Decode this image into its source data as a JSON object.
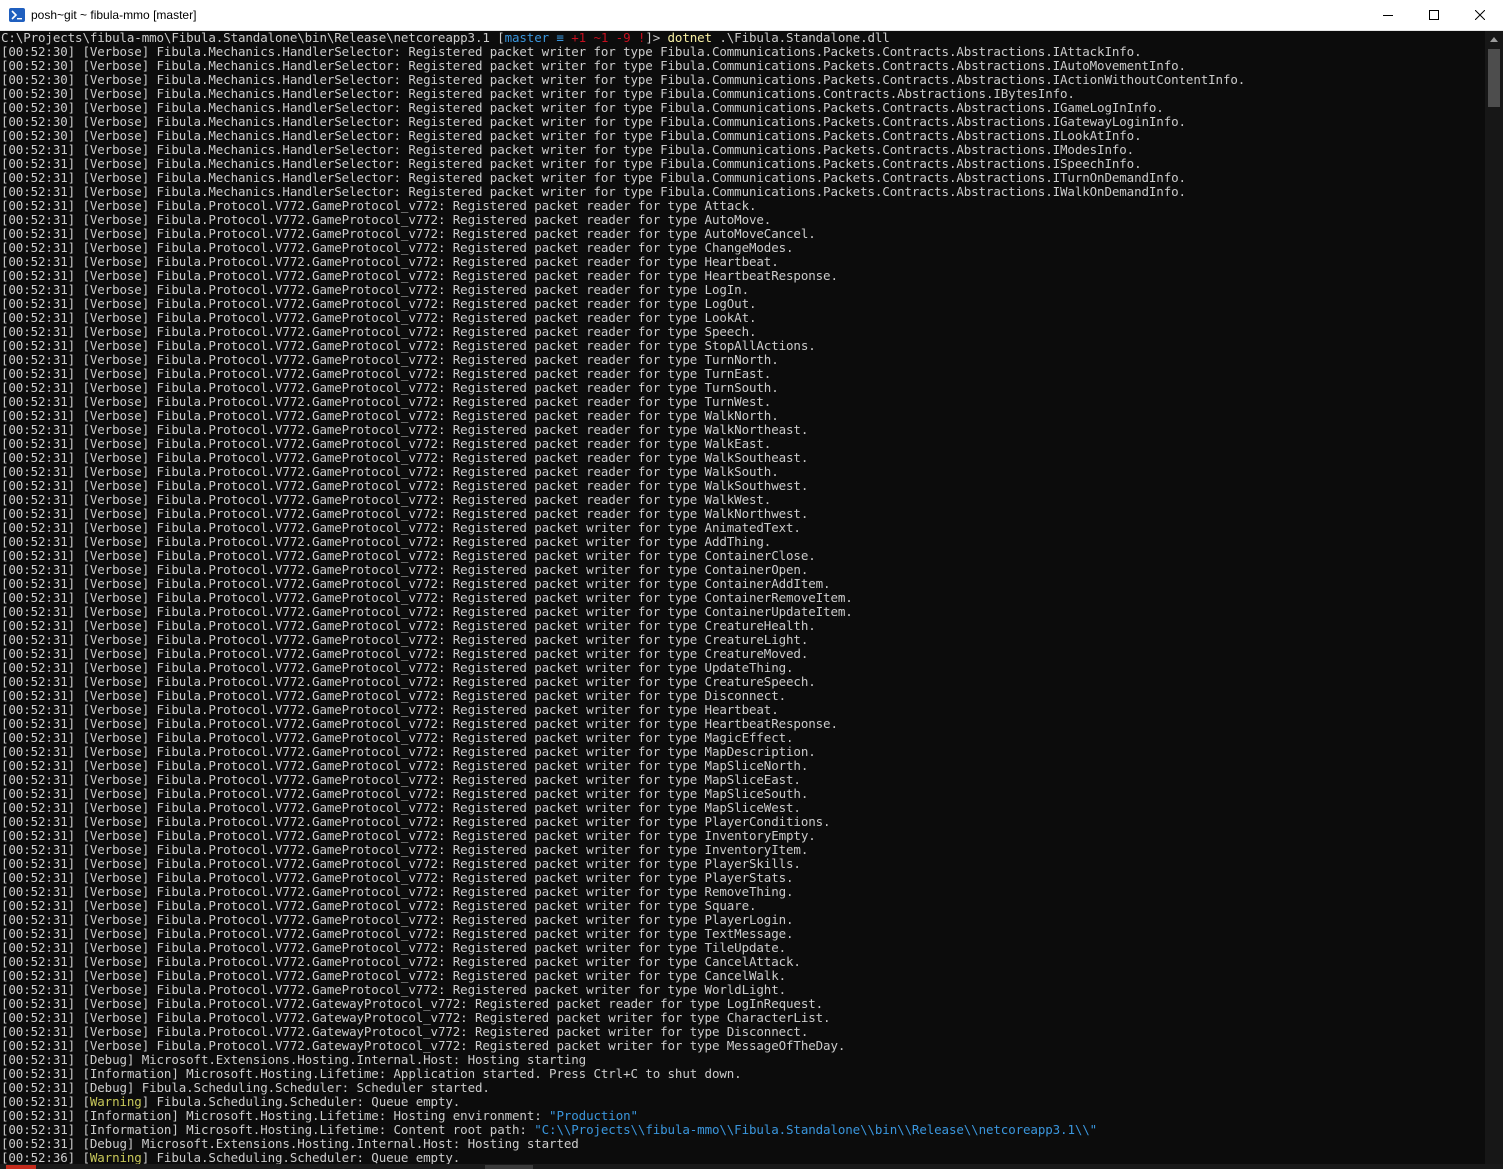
{
  "window": {
    "title": "posh~git ~ fibula-mmo [master]",
    "minimize_glyph": "—",
    "maximize_glyph": "☐",
    "close_glyph": "✕"
  },
  "prompt": {
    "path": "C:\\Projects\\fibula-mmo\\Fibula.Standalone\\bin\\Release\\netcoreapp3.1",
    "git_open": " [",
    "git_branch": "master ≡",
    "git_status": " +1 ~1 -9 !",
    "git_close": "]> ",
    "command": "dotnet",
    "args": " .\\Fibula.Standalone.dll"
  },
  "logs": [
    {
      "t": "00:52:30",
      "level": "Verbose",
      "src": "Fibula.Mechanics.HandlerSelector",
      "msg": "Registered packet writer for type Fibula.Communications.Packets.Contracts.Abstractions.IAttackInfo."
    },
    {
      "t": "00:52:30",
      "level": "Verbose",
      "src": "Fibula.Mechanics.HandlerSelector",
      "msg": "Registered packet writer for type Fibula.Communications.Packets.Contracts.Abstractions.IAutoMovementInfo."
    },
    {
      "t": "00:52:30",
      "level": "Verbose",
      "src": "Fibula.Mechanics.HandlerSelector",
      "msg": "Registered packet writer for type Fibula.Communications.Packets.Contracts.Abstractions.IActionWithoutContentInfo."
    },
    {
      "t": "00:52:30",
      "level": "Verbose",
      "src": "Fibula.Mechanics.HandlerSelector",
      "msg": "Registered packet writer for type Fibula.Communications.Contracts.Abstractions.IBytesInfo."
    },
    {
      "t": "00:52:30",
      "level": "Verbose",
      "src": "Fibula.Mechanics.HandlerSelector",
      "msg": "Registered packet writer for type Fibula.Communications.Packets.Contracts.Abstractions.IGameLogInInfo."
    },
    {
      "t": "00:52:30",
      "level": "Verbose",
      "src": "Fibula.Mechanics.HandlerSelector",
      "msg": "Registered packet writer for type Fibula.Communications.Packets.Contracts.Abstractions.IGatewayLoginInfo."
    },
    {
      "t": "00:52:30",
      "level": "Verbose",
      "src": "Fibula.Mechanics.HandlerSelector",
      "msg": "Registered packet writer for type Fibula.Communications.Packets.Contracts.Abstractions.ILookAtInfo."
    },
    {
      "t": "00:52:31",
      "level": "Verbose",
      "src": "Fibula.Mechanics.HandlerSelector",
      "msg": "Registered packet writer for type Fibula.Communications.Packets.Contracts.Abstractions.IModesInfo."
    },
    {
      "t": "00:52:31",
      "level": "Verbose",
      "src": "Fibula.Mechanics.HandlerSelector",
      "msg": "Registered packet writer for type Fibula.Communications.Packets.Contracts.Abstractions.ISpeechInfo."
    },
    {
      "t": "00:52:31",
      "level": "Verbose",
      "src": "Fibula.Mechanics.HandlerSelector",
      "msg": "Registered packet writer for type Fibula.Communications.Packets.Contracts.Abstractions.ITurnOnDemandInfo."
    },
    {
      "t": "00:52:31",
      "level": "Verbose",
      "src": "Fibula.Mechanics.HandlerSelector",
      "msg": "Registered packet writer for type Fibula.Communications.Packets.Contracts.Abstractions.IWalkOnDemandInfo."
    },
    {
      "t": "00:52:31",
      "level": "Verbose",
      "src": "Fibula.Protocol.V772.GameProtocol_v772",
      "msg": "Registered packet reader for type Attack."
    },
    {
      "t": "00:52:31",
      "level": "Verbose",
      "src": "Fibula.Protocol.V772.GameProtocol_v772",
      "msg": "Registered packet reader for type AutoMove."
    },
    {
      "t": "00:52:31",
      "level": "Verbose",
      "src": "Fibula.Protocol.V772.GameProtocol_v772",
      "msg": "Registered packet reader for type AutoMoveCancel."
    },
    {
      "t": "00:52:31",
      "level": "Verbose",
      "src": "Fibula.Protocol.V772.GameProtocol_v772",
      "msg": "Registered packet reader for type ChangeModes."
    },
    {
      "t": "00:52:31",
      "level": "Verbose",
      "src": "Fibula.Protocol.V772.GameProtocol_v772",
      "msg": "Registered packet reader for type Heartbeat."
    },
    {
      "t": "00:52:31",
      "level": "Verbose",
      "src": "Fibula.Protocol.V772.GameProtocol_v772",
      "msg": "Registered packet reader for type HeartbeatResponse."
    },
    {
      "t": "00:52:31",
      "level": "Verbose",
      "src": "Fibula.Protocol.V772.GameProtocol_v772",
      "msg": "Registered packet reader for type LogIn."
    },
    {
      "t": "00:52:31",
      "level": "Verbose",
      "src": "Fibula.Protocol.V772.GameProtocol_v772",
      "msg": "Registered packet reader for type LogOut."
    },
    {
      "t": "00:52:31",
      "level": "Verbose",
      "src": "Fibula.Protocol.V772.GameProtocol_v772",
      "msg": "Registered packet reader for type LookAt."
    },
    {
      "t": "00:52:31",
      "level": "Verbose",
      "src": "Fibula.Protocol.V772.GameProtocol_v772",
      "msg": "Registered packet reader for type Speech."
    },
    {
      "t": "00:52:31",
      "level": "Verbose",
      "src": "Fibula.Protocol.V772.GameProtocol_v772",
      "msg": "Registered packet reader for type StopAllActions."
    },
    {
      "t": "00:52:31",
      "level": "Verbose",
      "src": "Fibula.Protocol.V772.GameProtocol_v772",
      "msg": "Registered packet reader for type TurnNorth."
    },
    {
      "t": "00:52:31",
      "level": "Verbose",
      "src": "Fibula.Protocol.V772.GameProtocol_v772",
      "msg": "Registered packet reader for type TurnEast."
    },
    {
      "t": "00:52:31",
      "level": "Verbose",
      "src": "Fibula.Protocol.V772.GameProtocol_v772",
      "msg": "Registered packet reader for type TurnSouth."
    },
    {
      "t": "00:52:31",
      "level": "Verbose",
      "src": "Fibula.Protocol.V772.GameProtocol_v772",
      "msg": "Registered packet reader for type TurnWest."
    },
    {
      "t": "00:52:31",
      "level": "Verbose",
      "src": "Fibula.Protocol.V772.GameProtocol_v772",
      "msg": "Registered packet reader for type WalkNorth."
    },
    {
      "t": "00:52:31",
      "level": "Verbose",
      "src": "Fibula.Protocol.V772.GameProtocol_v772",
      "msg": "Registered packet reader for type WalkNortheast."
    },
    {
      "t": "00:52:31",
      "level": "Verbose",
      "src": "Fibula.Protocol.V772.GameProtocol_v772",
      "msg": "Registered packet reader for type WalkEast."
    },
    {
      "t": "00:52:31",
      "level": "Verbose",
      "src": "Fibula.Protocol.V772.GameProtocol_v772",
      "msg": "Registered packet reader for type WalkSoutheast."
    },
    {
      "t": "00:52:31",
      "level": "Verbose",
      "src": "Fibula.Protocol.V772.GameProtocol_v772",
      "msg": "Registered packet reader for type WalkSouth."
    },
    {
      "t": "00:52:31",
      "level": "Verbose",
      "src": "Fibula.Protocol.V772.GameProtocol_v772",
      "msg": "Registered packet reader for type WalkSouthwest."
    },
    {
      "t": "00:52:31",
      "level": "Verbose",
      "src": "Fibula.Protocol.V772.GameProtocol_v772",
      "msg": "Registered packet reader for type WalkWest."
    },
    {
      "t": "00:52:31",
      "level": "Verbose",
      "src": "Fibula.Protocol.V772.GameProtocol_v772",
      "msg": "Registered packet reader for type WalkNorthwest."
    },
    {
      "t": "00:52:31",
      "level": "Verbose",
      "src": "Fibula.Protocol.V772.GameProtocol_v772",
      "msg": "Registered packet writer for type AnimatedText."
    },
    {
      "t": "00:52:31",
      "level": "Verbose",
      "src": "Fibula.Protocol.V772.GameProtocol_v772",
      "msg": "Registered packet writer for type AddThing."
    },
    {
      "t": "00:52:31",
      "level": "Verbose",
      "src": "Fibula.Protocol.V772.GameProtocol_v772",
      "msg": "Registered packet writer for type ContainerClose."
    },
    {
      "t": "00:52:31",
      "level": "Verbose",
      "src": "Fibula.Protocol.V772.GameProtocol_v772",
      "msg": "Registered packet writer for type ContainerOpen."
    },
    {
      "t": "00:52:31",
      "level": "Verbose",
      "src": "Fibula.Protocol.V772.GameProtocol_v772",
      "msg": "Registered packet writer for type ContainerAddItem."
    },
    {
      "t": "00:52:31",
      "level": "Verbose",
      "src": "Fibula.Protocol.V772.GameProtocol_v772",
      "msg": "Registered packet writer for type ContainerRemoveItem."
    },
    {
      "t": "00:52:31",
      "level": "Verbose",
      "src": "Fibula.Protocol.V772.GameProtocol_v772",
      "msg": "Registered packet writer for type ContainerUpdateItem."
    },
    {
      "t": "00:52:31",
      "level": "Verbose",
      "src": "Fibula.Protocol.V772.GameProtocol_v772",
      "msg": "Registered packet writer for type CreatureHealth."
    },
    {
      "t": "00:52:31",
      "level": "Verbose",
      "src": "Fibula.Protocol.V772.GameProtocol_v772",
      "msg": "Registered packet writer for type CreatureLight."
    },
    {
      "t": "00:52:31",
      "level": "Verbose",
      "src": "Fibula.Protocol.V772.GameProtocol_v772",
      "msg": "Registered packet writer for type CreatureMoved."
    },
    {
      "t": "00:52:31",
      "level": "Verbose",
      "src": "Fibula.Protocol.V772.GameProtocol_v772",
      "msg": "Registered packet writer for type UpdateThing."
    },
    {
      "t": "00:52:31",
      "level": "Verbose",
      "src": "Fibula.Protocol.V772.GameProtocol_v772",
      "msg": "Registered packet writer for type CreatureSpeech."
    },
    {
      "t": "00:52:31",
      "level": "Verbose",
      "src": "Fibula.Protocol.V772.GameProtocol_v772",
      "msg": "Registered packet writer for type Disconnect."
    },
    {
      "t": "00:52:31",
      "level": "Verbose",
      "src": "Fibula.Protocol.V772.GameProtocol_v772",
      "msg": "Registered packet writer for type Heartbeat."
    },
    {
      "t": "00:52:31",
      "level": "Verbose",
      "src": "Fibula.Protocol.V772.GameProtocol_v772",
      "msg": "Registered packet writer for type HeartbeatResponse."
    },
    {
      "t": "00:52:31",
      "level": "Verbose",
      "src": "Fibula.Protocol.V772.GameProtocol_v772",
      "msg": "Registered packet writer for type MagicEffect."
    },
    {
      "t": "00:52:31",
      "level": "Verbose",
      "src": "Fibula.Protocol.V772.GameProtocol_v772",
      "msg": "Registered packet writer for type MapDescription."
    },
    {
      "t": "00:52:31",
      "level": "Verbose",
      "src": "Fibula.Protocol.V772.GameProtocol_v772",
      "msg": "Registered packet writer for type MapSliceNorth."
    },
    {
      "t": "00:52:31",
      "level": "Verbose",
      "src": "Fibula.Protocol.V772.GameProtocol_v772",
      "msg": "Registered packet writer for type MapSliceEast."
    },
    {
      "t": "00:52:31",
      "level": "Verbose",
      "src": "Fibula.Protocol.V772.GameProtocol_v772",
      "msg": "Registered packet writer for type MapSliceSouth."
    },
    {
      "t": "00:52:31",
      "level": "Verbose",
      "src": "Fibula.Protocol.V772.GameProtocol_v772",
      "msg": "Registered packet writer for type MapSliceWest."
    },
    {
      "t": "00:52:31",
      "level": "Verbose",
      "src": "Fibula.Protocol.V772.GameProtocol_v772",
      "msg": "Registered packet writer for type PlayerConditions."
    },
    {
      "t": "00:52:31",
      "level": "Verbose",
      "src": "Fibula.Protocol.V772.GameProtocol_v772",
      "msg": "Registered packet writer for type InventoryEmpty."
    },
    {
      "t": "00:52:31",
      "level": "Verbose",
      "src": "Fibula.Protocol.V772.GameProtocol_v772",
      "msg": "Registered packet writer for type InventoryItem."
    },
    {
      "t": "00:52:31",
      "level": "Verbose",
      "src": "Fibula.Protocol.V772.GameProtocol_v772",
      "msg": "Registered packet writer for type PlayerSkills."
    },
    {
      "t": "00:52:31",
      "level": "Verbose",
      "src": "Fibula.Protocol.V772.GameProtocol_v772",
      "msg": "Registered packet writer for type PlayerStats."
    },
    {
      "t": "00:52:31",
      "level": "Verbose",
      "src": "Fibula.Protocol.V772.GameProtocol_v772",
      "msg": "Registered packet writer for type RemoveThing."
    },
    {
      "t": "00:52:31",
      "level": "Verbose",
      "src": "Fibula.Protocol.V772.GameProtocol_v772",
      "msg": "Registered packet writer for type Square."
    },
    {
      "t": "00:52:31",
      "level": "Verbose",
      "src": "Fibula.Protocol.V772.GameProtocol_v772",
      "msg": "Registered packet writer for type PlayerLogin."
    },
    {
      "t": "00:52:31",
      "level": "Verbose",
      "src": "Fibula.Protocol.V772.GameProtocol_v772",
      "msg": "Registered packet writer for type TextMessage."
    },
    {
      "t": "00:52:31",
      "level": "Verbose",
      "src": "Fibula.Protocol.V772.GameProtocol_v772",
      "msg": "Registered packet writer for type TileUpdate."
    },
    {
      "t": "00:52:31",
      "level": "Verbose",
      "src": "Fibula.Protocol.V772.GameProtocol_v772",
      "msg": "Registered packet writer for type CancelAttack."
    },
    {
      "t": "00:52:31",
      "level": "Verbose",
      "src": "Fibula.Protocol.V772.GameProtocol_v772",
      "msg": "Registered packet writer for type CancelWalk."
    },
    {
      "t": "00:52:31",
      "level": "Verbose",
      "src": "Fibula.Protocol.V772.GameProtocol_v772",
      "msg": "Registered packet writer for type WorldLight."
    },
    {
      "t": "00:52:31",
      "level": "Verbose",
      "src": "Fibula.Protocol.V772.GatewayProtocol_v772",
      "msg": "Registered packet reader for type LogInRequest."
    },
    {
      "t": "00:52:31",
      "level": "Verbose",
      "src": "Fibula.Protocol.V772.GatewayProtocol_v772",
      "msg": "Registered packet writer for type CharacterList."
    },
    {
      "t": "00:52:31",
      "level": "Verbose",
      "src": "Fibula.Protocol.V772.GatewayProtocol_v772",
      "msg": "Registered packet writer for type Disconnect."
    },
    {
      "t": "00:52:31",
      "level": "Verbose",
      "src": "Fibula.Protocol.V772.GatewayProtocol_v772",
      "msg": "Registered packet writer for type MessageOfTheDay."
    },
    {
      "t": "00:52:31",
      "level": "Debug",
      "src": "Microsoft.Extensions.Hosting.Internal.Host",
      "msg": "Hosting starting"
    },
    {
      "t": "00:52:31",
      "level": "Information",
      "src": "Microsoft.Hosting.Lifetime",
      "msg": "Application started. Press Ctrl+C to shut down."
    },
    {
      "t": "00:52:31",
      "level": "Debug",
      "src": "Fibula.Scheduling.Scheduler",
      "msg": "Scheduler started."
    },
    {
      "t": "00:52:31",
      "level": "Warning",
      "src": "Fibula.Scheduling.Scheduler",
      "msg": "Queue empty."
    },
    {
      "t": "00:52:31",
      "level": "Information",
      "src": "Microsoft.Hosting.Lifetime",
      "msg": "Hosting environment: ",
      "str": "\"Production\""
    },
    {
      "t": "00:52:31",
      "level": "Information",
      "src": "Microsoft.Hosting.Lifetime",
      "msg": "Content root path: ",
      "str": "\"C:\\\\Projects\\\\fibula-mmo\\\\Fibula.Standalone\\\\bin\\\\Release\\\\netcoreapp3.1\\\\\""
    },
    {
      "t": "00:52:31",
      "level": "Debug",
      "src": "Microsoft.Extensions.Hosting.Internal.Host",
      "msg": "Hosting started"
    },
    {
      "t": "00:52:36",
      "level": "Warning",
      "src": "Fibula.Scheduling.Scheduler",
      "msg": "Queue empty."
    }
  ],
  "colors": {
    "console_bg": "#0c0c0c",
    "console_fg": "#cccccc",
    "warning": "#c8c85a",
    "string": "#3a96dd",
    "git_branch": "#3a96dd",
    "git_status": "#c50f1f",
    "command": "#f9f1a5"
  },
  "icons": {
    "app": "powershell-icon",
    "minimize": "minimize-icon",
    "maximize": "maximize-icon",
    "close": "close-icon",
    "scroll_up": "scroll-up-arrow-icon"
  }
}
